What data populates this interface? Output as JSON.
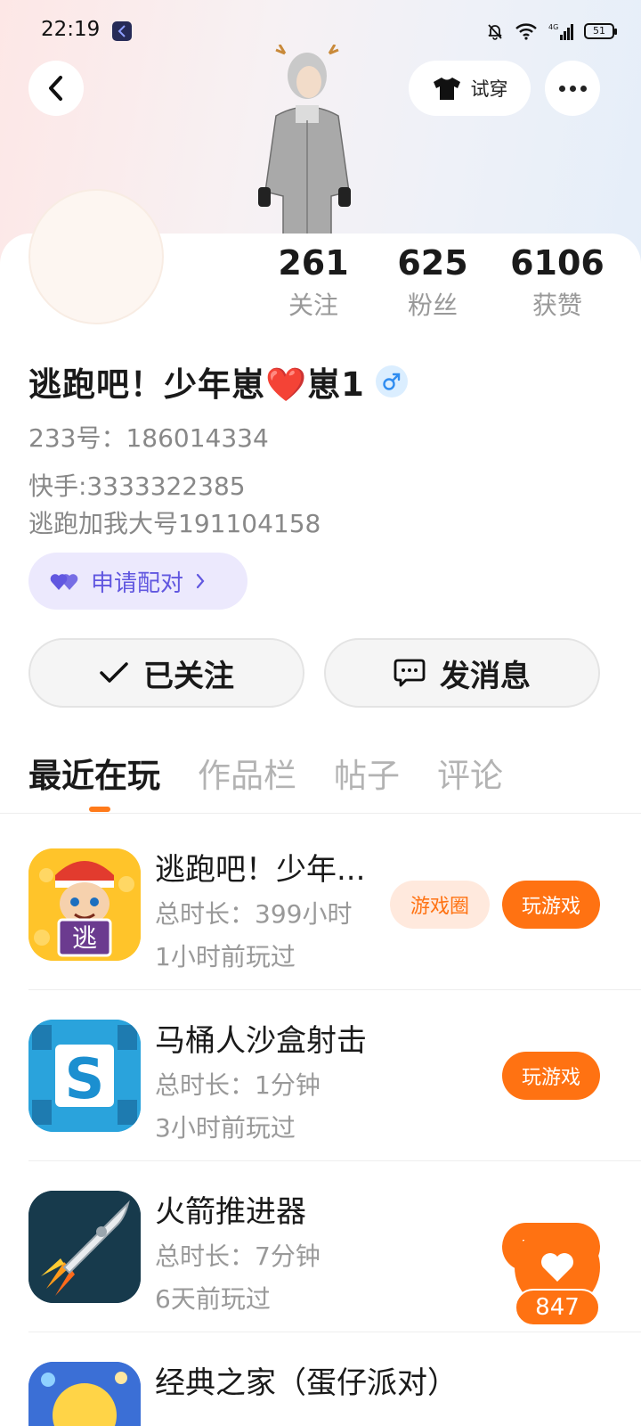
{
  "status_bar": {
    "time": "22:19",
    "battery": "51"
  },
  "header": {
    "try_on_label": "试穿"
  },
  "profile": {
    "stats": [
      {
        "value": "261",
        "label": "关注"
      },
      {
        "value": "625",
        "label": "粉丝"
      },
      {
        "value": "6106",
        "label": "获赞"
      }
    ],
    "name": "逃跑吧！少年崽❤️崽1",
    "gender": "male",
    "id_line": "233号：186014334",
    "bio_lines": [
      "快手:3333322385",
      "逃跑加我大号191104158"
    ],
    "pair_button_label": "申请配对",
    "follow_button_label": "已关注",
    "message_button_label": "发消息"
  },
  "tabs": [
    {
      "label": "最近在玩",
      "active": true
    },
    {
      "label": "作品栏",
      "active": false
    },
    {
      "label": "帖子",
      "active": false
    },
    {
      "label": "评论",
      "active": false
    }
  ],
  "games": [
    {
      "title": "逃跑吧！少年...",
      "duration": "总时长：399小时",
      "last_played": "1小时前玩过",
      "circle_label": "游戏圈",
      "play_label": "玩游戏"
    },
    {
      "title": "马桶人沙盒射击",
      "duration": "总时长：1分钟",
      "last_played": "3小时前玩过",
      "play_label": "玩游戏"
    },
    {
      "title": "火箭推进器",
      "duration": "总时长：7分钟",
      "last_played": "6天前玩过",
      "play_label": "玩游戏"
    },
    {
      "title": "经典之家（蛋仔派对）"
    }
  ],
  "floating_like": {
    "count": "847"
  },
  "colors": {
    "accent": "#ff7212",
    "pair_purple": "#6157e0",
    "muted_text": "#999999"
  }
}
